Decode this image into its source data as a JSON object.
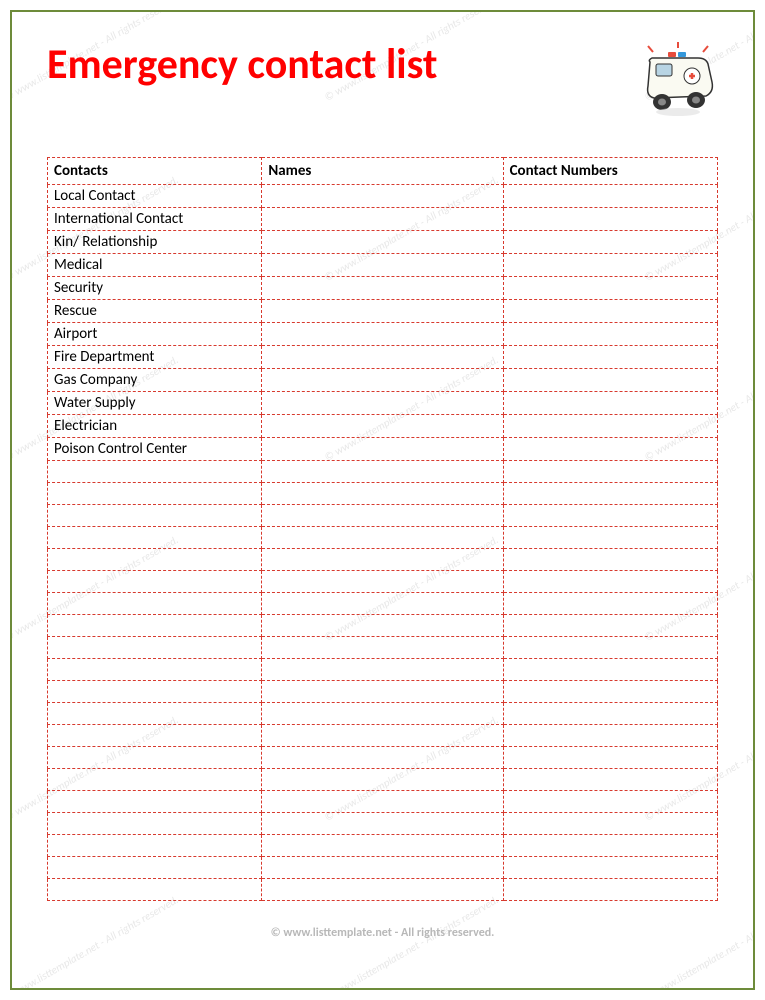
{
  "title": "Emergency contact list",
  "headers": {
    "contacts": "Contacts",
    "names": "Names",
    "numbers": "Contact Numbers"
  },
  "rows": [
    {
      "contact": "Local Contact",
      "name": "",
      "number": ""
    },
    {
      "contact": "International Contact",
      "name": "",
      "number": ""
    },
    {
      "contact": "Kin/ Relationship",
      "name": "",
      "number": ""
    },
    {
      "contact": "Medical",
      "name": "",
      "number": ""
    },
    {
      "contact": "Security",
      "name": "",
      "number": ""
    },
    {
      "contact": "Rescue",
      "name": "",
      "number": ""
    },
    {
      "contact": "Airport",
      "name": "",
      "number": ""
    },
    {
      "contact": "Fire Department",
      "name": "",
      "number": ""
    },
    {
      "contact": "Gas Company",
      "name": "",
      "number": ""
    },
    {
      "contact": "Water Supply",
      "name": "",
      "number": ""
    },
    {
      "contact": "Electrician",
      "name": "",
      "number": ""
    },
    {
      "contact": "Poison Control Center",
      "name": "",
      "number": ""
    },
    {
      "contact": "",
      "name": "",
      "number": ""
    },
    {
      "contact": "",
      "name": "",
      "number": ""
    },
    {
      "contact": "",
      "name": "",
      "number": ""
    },
    {
      "contact": "",
      "name": "",
      "number": ""
    },
    {
      "contact": "",
      "name": "",
      "number": ""
    },
    {
      "contact": "",
      "name": "",
      "number": ""
    },
    {
      "contact": "",
      "name": "",
      "number": ""
    },
    {
      "contact": "",
      "name": "",
      "number": ""
    },
    {
      "contact": "",
      "name": "",
      "number": ""
    },
    {
      "contact": "",
      "name": "",
      "number": ""
    },
    {
      "contact": "",
      "name": "",
      "number": ""
    },
    {
      "contact": "",
      "name": "",
      "number": ""
    },
    {
      "contact": "",
      "name": "",
      "number": ""
    },
    {
      "contact": "",
      "name": "",
      "number": ""
    },
    {
      "contact": "",
      "name": "",
      "number": ""
    },
    {
      "contact": "",
      "name": "",
      "number": ""
    },
    {
      "contact": "",
      "name": "",
      "number": ""
    },
    {
      "contact": "",
      "name": "",
      "number": ""
    },
    {
      "contact": "",
      "name": "",
      "number": ""
    },
    {
      "contact": "",
      "name": "",
      "number": ""
    }
  ],
  "footer": "© www.listtemplate.net - All rights reserved.",
  "watermark": "© www.listtemplate.net - All rights reserved."
}
